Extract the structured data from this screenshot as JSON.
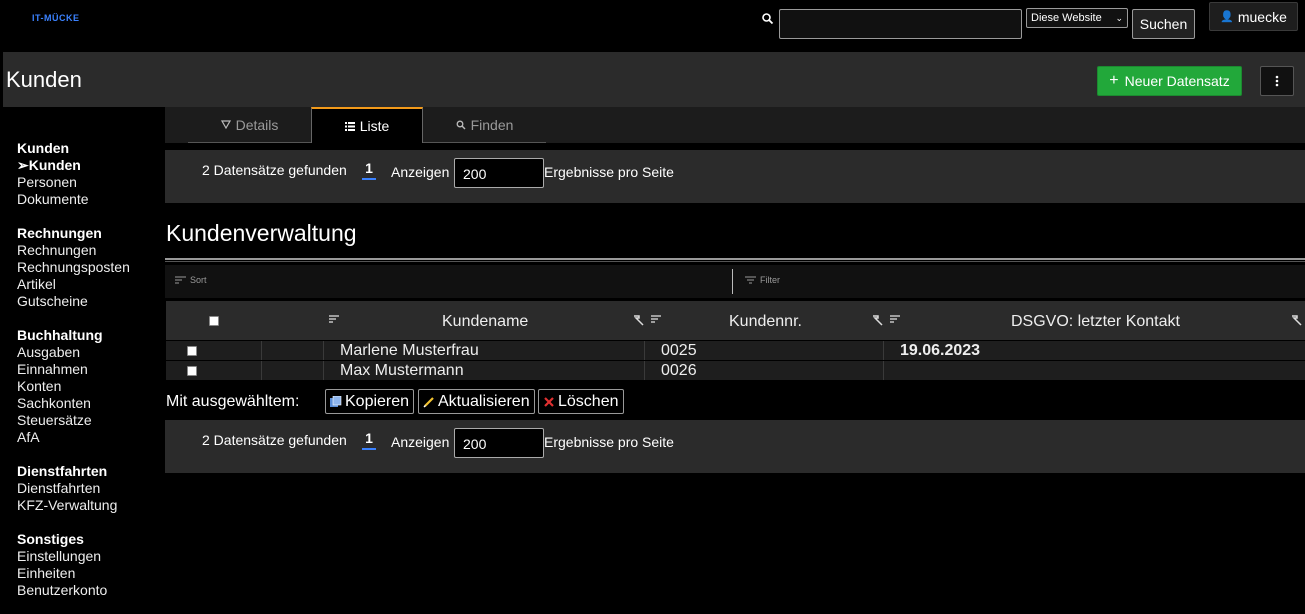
{
  "app": {
    "logo": "IT-MÜCKE",
    "title": "Kunden"
  },
  "search": {
    "placeholder": "",
    "scope": "Diese Website",
    "button": "Suchen"
  },
  "user": {
    "name": "muecke"
  },
  "actions": {
    "new_record": "Neuer Datensatz"
  },
  "sidebar": {
    "groups": [
      {
        "title": "Kunden",
        "items": [
          "➢Kunden",
          "Personen",
          "Dokumente"
        ],
        "active": 0
      },
      {
        "title": "Rechnungen",
        "items": [
          "Rechnungen",
          "Rechnungsposten",
          "Artikel",
          "Gutscheine"
        ]
      },
      {
        "title": "Buchhaltung",
        "items": [
          "Ausgaben",
          "Einnahmen",
          "Konten",
          "Sachkonten",
          "Steuersätze",
          "AfA"
        ]
      },
      {
        "title": "Dienstfahrten",
        "items": [
          "Dienstfahrten",
          "KFZ-Verwaltung"
        ]
      },
      {
        "title": "Sonstiges",
        "items": [
          "Einstellungen",
          "Einheiten",
          "Benutzerkonto"
        ]
      }
    ]
  },
  "tabs": [
    {
      "label": "Details",
      "icon": "triangle-down-icon"
    },
    {
      "label": "Liste",
      "icon": "list-icon",
      "active": true
    },
    {
      "label": "Finden",
      "icon": "search-icon"
    }
  ],
  "pager": {
    "found": "2 Datensätze gefunden",
    "page": "1",
    "show_label": "Anzeigen",
    "per_page": "200",
    "per_page_label": "Ergebnisse pro Seite"
  },
  "section": {
    "heading": "Kundenverwaltung",
    "sort_placeholder": "Sort",
    "filter_placeholder": "Filter"
  },
  "table": {
    "columns": [
      "Kundename",
      "Kundennr.",
      "DSGVO: letzter Kontakt"
    ],
    "rows": [
      {
        "name": "Marlene Musterfrau",
        "number": "0025",
        "last_contact": "19.06.2023"
      },
      {
        "name": "Max Mustermann",
        "number": "0026",
        "last_contact": ""
      }
    ]
  },
  "bulk": {
    "label": "Mit ausgewähltem:",
    "copy": "Kopieren",
    "update": "Aktualisieren",
    "delete": "Löschen"
  },
  "colors": {
    "accent_green": "#22a83a",
    "tab_active": "#f29a1a",
    "link_blue": "#3b82ff"
  }
}
